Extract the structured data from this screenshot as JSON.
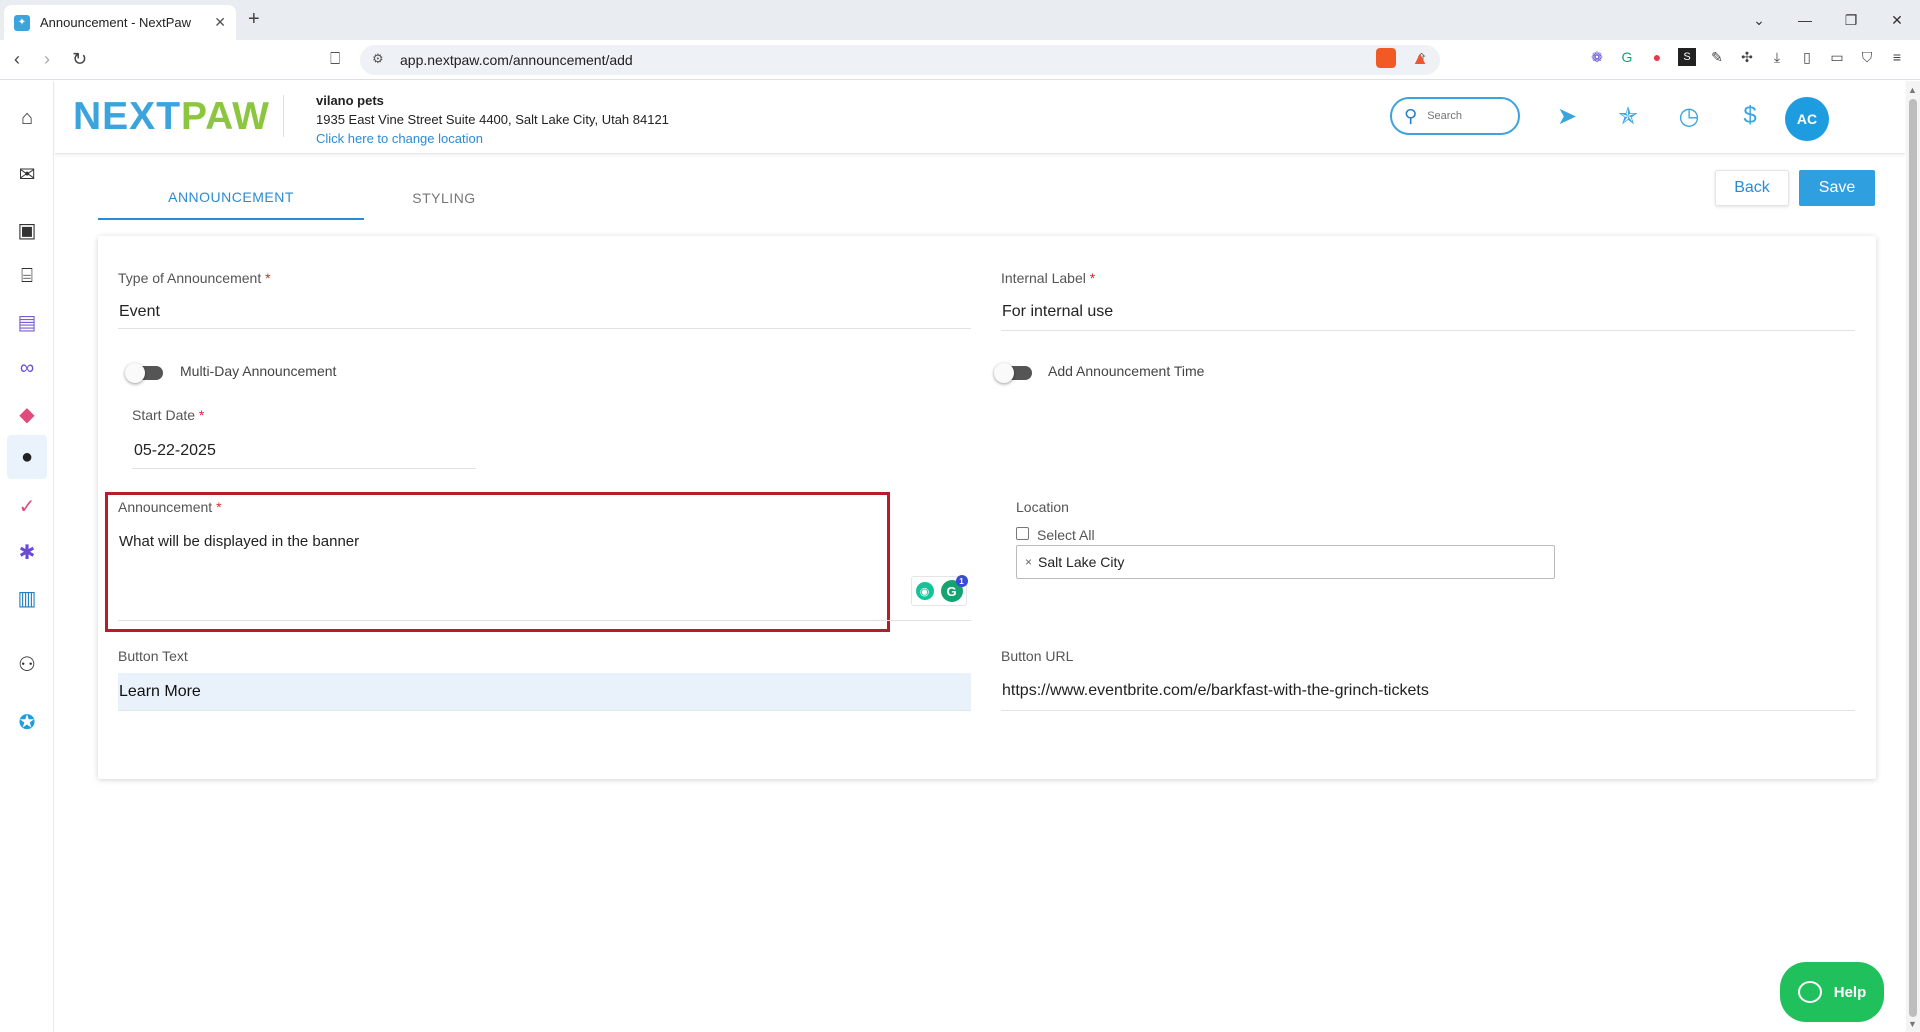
{
  "browser": {
    "tab_title": "Announcement - NextPaw",
    "tab_close": "✕",
    "new_tab": "+",
    "url": "app.nextpaw.com/announcement/add"
  },
  "header": {
    "logo_next": "NEXT",
    "logo_paw": "PAW",
    "business_name": "vilano pets",
    "business_address": "1935 East Vine Street Suite 4400, Salt Lake City, Utah 84121",
    "change_location_link": "Click here to change location",
    "search_placeholder": "Search",
    "avatar_initials": "AC"
  },
  "tabs": {
    "announcement": "ANNOUNCEMENT",
    "styling": "STYLING"
  },
  "actions": {
    "back": "Back",
    "save": "Save"
  },
  "form": {
    "type_label": "Type of Announcement",
    "type_value": "Event",
    "internal_label_label": "Internal Label",
    "internal_label_value": "For internal use",
    "multi_day_label": "Multi-Day Announcement",
    "add_time_label": "Add Announcement Time",
    "start_date_label": "Start Date",
    "start_date_value": "05-22-2025",
    "announcement_label": "Announcement",
    "announcement_value": "What will be displayed in the banner",
    "location_label": "Location",
    "select_all_label": "Select All",
    "location_chip": "Salt Lake City",
    "button_text_label": "Button Text",
    "button_text_value": "Learn More",
    "button_url_label": "Button URL",
    "button_url_value": "https://www.eventbrite.com/e/barkfast-with-the-grinch-tickets",
    "required_mark": "*"
  },
  "grammarly": {
    "badge_count": "1"
  },
  "help": {
    "label": "Help"
  },
  "colors": {
    "brand_blue": "#3ba4dd",
    "brand_green": "#8cc63f",
    "save_button": "#2f9fe0",
    "help_button": "#20c05c",
    "highlight_border": "#b71c2c"
  }
}
